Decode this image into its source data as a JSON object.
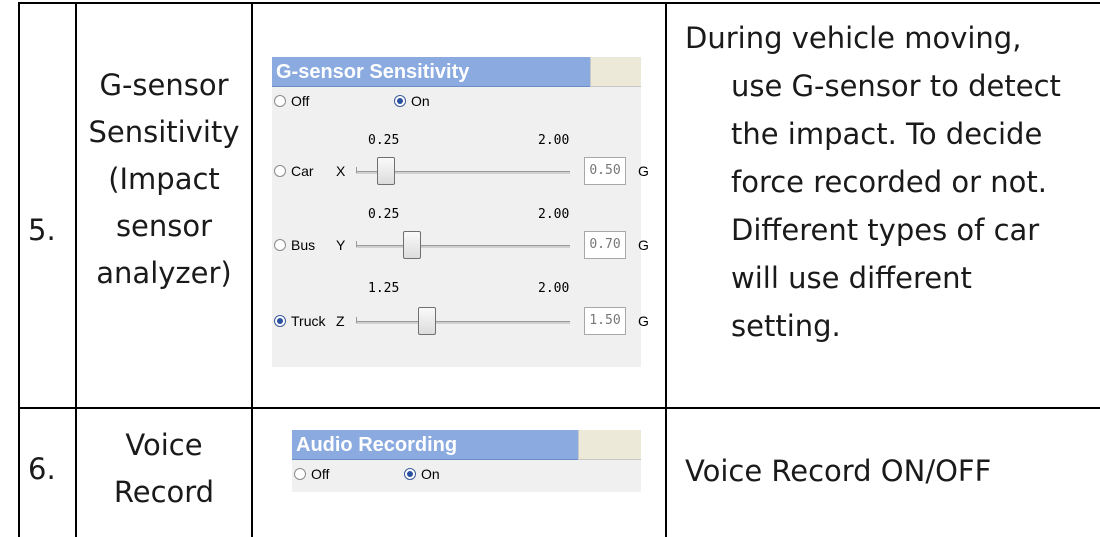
{
  "rows": [
    {
      "num": "5.",
      "name_lines": [
        "G-sensor",
        "Sensitivity",
        "(Impact",
        "sensor",
        "analyzer)"
      ],
      "desc_lines": [
        "During vehicle moving,",
        "use G-sensor to detect",
        "the impact. To decide",
        "force recorded or not.",
        "Different types of car",
        "will use different",
        "setting."
      ],
      "panel": {
        "title": "G-sensor Sensitivity",
        "radio_off": "Off",
        "radio_on": "On",
        "selected_mode": "On",
        "sliders": [
          {
            "vehicle": "Car",
            "axis": "X",
            "min_label": "0.25",
            "max_label": "2.00",
            "value": "0.50",
            "unit": "G",
            "selected": false,
            "fraction": 0.14
          },
          {
            "vehicle": "Bus",
            "axis": "Y",
            "min_label": "0.25",
            "max_label": "2.00",
            "value": "0.70",
            "unit": "G",
            "selected": false,
            "fraction": 0.26
          },
          {
            "vehicle": "Truck",
            "axis": "Z",
            "min_label": "1.25",
            "max_label": "2.00",
            "value": "1.50",
            "unit": "G",
            "selected": true,
            "fraction": 0.33
          }
        ]
      }
    },
    {
      "num": "6.",
      "name_lines": [
        "Voice",
        "Record"
      ],
      "desc_lines": [
        "Voice Record ON/OFF"
      ],
      "panel": {
        "title": "Audio Recording",
        "radio_off": "Off",
        "radio_on": "On",
        "selected_mode": "On"
      }
    }
  ]
}
